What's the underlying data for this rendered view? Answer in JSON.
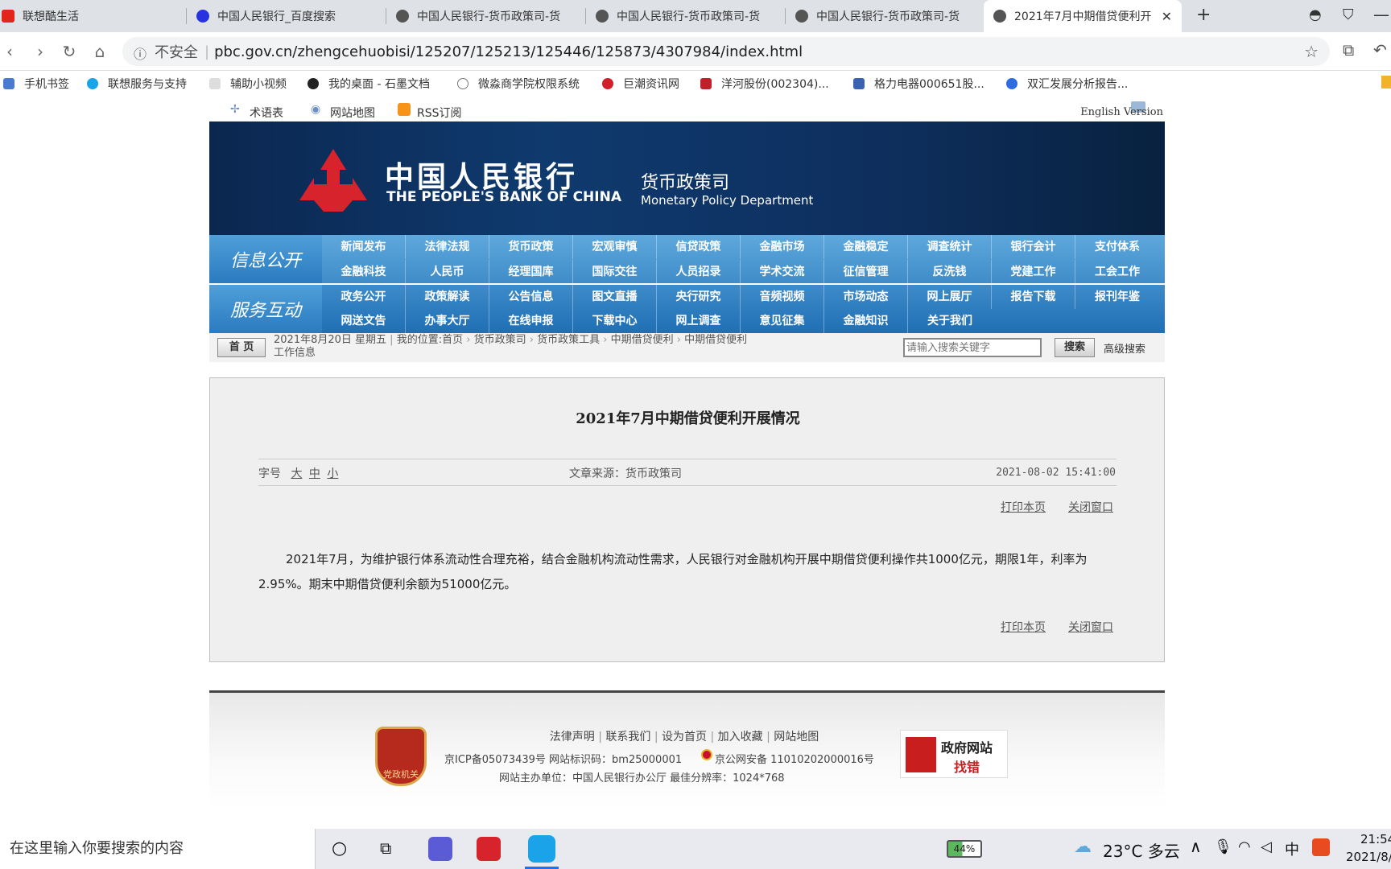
{
  "browser": {
    "tabs": [
      {
        "title": "联想酷生活",
        "color": "#e1251b"
      },
      {
        "title": "中国人民银行_百度搜索",
        "color": "#2932e1"
      },
      {
        "title": "中国人民银行-货币政策司-货",
        "color": "#555555"
      },
      {
        "title": "中国人民银行-货币政策司-货",
        "color": "#555555"
      },
      {
        "title": "中国人民银行-货币政策司-货",
        "color": "#555555"
      },
      {
        "title": "2021年7月中期借贷便利开",
        "color": "#555555"
      }
    ],
    "security_label": "不安全",
    "url": "pbc.gov.cn/zhengcehuobisi/125207/125213/125446/125873/4307984/index.html",
    "bookmarks": [
      "手机书签",
      "联想服务与支持",
      "辅助小视频",
      "我的桌面 - 石墨文档",
      "微淼商学院权限系统",
      "巨潮资讯网",
      "洋河股份(002304)...",
      "格力电器000651股...",
      "双汇发展分析报告..."
    ]
  },
  "site": {
    "top_links": [
      "术语表",
      "网站地图",
      "RSS订阅"
    ],
    "english_link": "English Version",
    "bank_name_cn": "中国人民银行",
    "bank_name_en": "THE PEOPLE'S BANK OF CHINA",
    "dept_cn": "货币政策司",
    "dept_en": "Monetary Policy Department",
    "nav": {
      "info_label": "信息公开",
      "service_label": "服务互动",
      "row1": [
        "新闻发布",
        "法律法规",
        "货币政策",
        "宏观审慎",
        "信贷政策",
        "金融市场",
        "金融稳定",
        "调查统计",
        "银行会计",
        "支付体系"
      ],
      "row2": [
        "金融科技",
        "人民币",
        "经理国库",
        "国际交往",
        "人员招录",
        "学术交流",
        "征信管理",
        "反洗钱",
        "党建工作",
        "工会工作"
      ],
      "row3": [
        "政务公开",
        "政策解读",
        "公告信息",
        "图文直播",
        "央行研究",
        "音频视频",
        "市场动态",
        "网上展厅",
        "报告下载",
        "报刊年鉴"
      ],
      "row4": [
        "网送文告",
        "办事大厅",
        "在线申报",
        "下载中心",
        "网上调查",
        "意见征集",
        "金融知识",
        "关于我们"
      ]
    },
    "crumb": {
      "home_btn": "首 页",
      "date": "2021年8月20日  星期五",
      "location_label": "我的位置:首页",
      "path": [
        "货币政策司",
        "货币政策工具",
        "中期借贷便利",
        "中期借贷便利"
      ],
      "path_tail": "工作信息",
      "search_placeholder": "请输入搜索关键字",
      "search_btn": "搜索",
      "adv_search": "高级搜索"
    }
  },
  "article": {
    "title": "2021年7月中期借贷便利开展情况",
    "font_label": "字号",
    "font_sizes": [
      "大",
      "中",
      "小"
    ],
    "source": "文章来源：货币政策司",
    "datetime": "2021-08-02 15:41:00",
    "print": "打印本页",
    "close": "关闭窗口",
    "body": "2021年7月，为维护银行体系流动性合理充裕，结合金融机构流动性需求，人民银行对金融机构开展中期借贷便利操作共1000亿元，期限1年，利率为2.95%。期末中期借贷便利余额为51000亿元。"
  },
  "footer": {
    "links": [
      "法律声明",
      "联系我们",
      "设为首页",
      "加入收藏",
      "网站地图"
    ],
    "icp": "京ICP备05073439号  网站标识码：bm25000001",
    "police": "京公网安备 11010202000016号",
    "host": "网站主办单位：中国人民银行办公厅   最佳分辨率：1024*768",
    "badge_label": "党政机关",
    "gov_error_title": "政府网站",
    "gov_error_sub": "找错"
  },
  "taskbar": {
    "search_placeholder": "在这里输入你要搜索的内容",
    "battery": "44%",
    "weather": "23°C  多云",
    "ime": "中",
    "time": "21:54",
    "date": "2021/8/"
  }
}
